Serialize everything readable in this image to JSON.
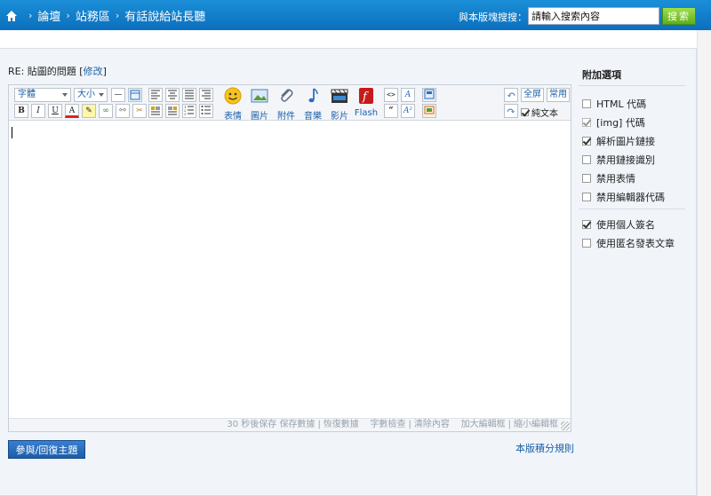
{
  "breadcrumb": {
    "items": [
      "論壇",
      "站務區",
      "有話說給站長聽"
    ]
  },
  "search": {
    "label": "與本版塊搜搜：",
    "placeholder": "請輸入搜索內容",
    "value": "請輸入搜索內容",
    "button": "搜索"
  },
  "post": {
    "title_prefix": "RE: 貼圖的問題 ",
    "edit_link": "修改"
  },
  "toolbar": {
    "font": "字體",
    "size": "大小",
    "big_buttons": [
      "表情",
      "圖片",
      "附件",
      "音樂",
      "影片",
      "Flash"
    ],
    "fullscreen": "全屏",
    "common": "常用",
    "plain_text": "純文本"
  },
  "status": {
    "autosave": "30 秒後保存",
    "save": "保存數據",
    "restore": "恢復數據",
    "count": "字數檢查",
    "clear": "清除內容",
    "enlarge": "加大編輯框",
    "shrink": "縮小編輯框"
  },
  "reply_button": "參與/回復主題",
  "rules_link": "本版積分規則",
  "options": {
    "title": "附加選項",
    "items": [
      {
        "label": "HTML 代碼",
        "checked": false
      },
      {
        "label": "[img] 代碼",
        "checked": true,
        "disabled": true
      },
      {
        "label": "解析圖片鏈接",
        "checked": true
      },
      {
        "label": "禁用鏈接識別",
        "checked": false
      },
      {
        "label": "禁用表情",
        "checked": false
      },
      {
        "label": "禁用編輯器代碼",
        "checked": false
      },
      {
        "label": "使用個人簽名",
        "checked": true
      },
      {
        "label": "使用匿名發表文章",
        "checked": false
      }
    ]
  }
}
